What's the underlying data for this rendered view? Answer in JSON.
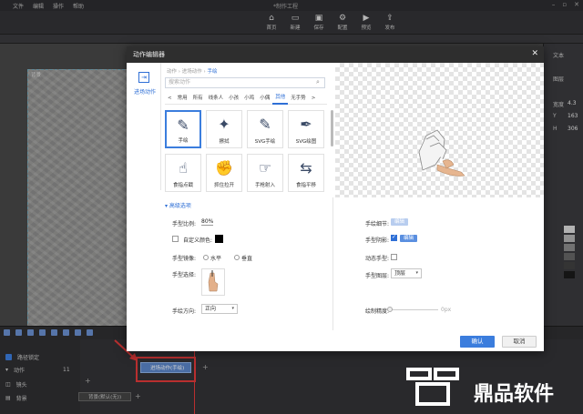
{
  "app": {
    "window_title": "*制作工程",
    "menus": [
      "文件",
      "编辑",
      "操作",
      "帮助"
    ]
  },
  "toolbar": [
    {
      "label": "首页",
      "icon": "home-icon"
    },
    {
      "label": "新建",
      "icon": "new-icon"
    },
    {
      "label": "保存",
      "icon": "save-icon"
    },
    {
      "label": "配置",
      "icon": "settings-icon"
    },
    {
      "label": "预览",
      "icon": "preview-icon"
    },
    {
      "label": "发布",
      "icon": "publish-icon"
    }
  ],
  "canvas": {
    "paper_label": "背景"
  },
  "right_panel": {
    "tab": "文本",
    "section": "图层",
    "x_label": "宽度",
    "x_value": "4.3",
    "y_label": "Y",
    "y_value": "163",
    "h_label": "H",
    "h_value": "306",
    "palette": [
      "#d9d9d9",
      "#b3b3b3",
      "#8c8c8c",
      "#666666",
      "#404040",
      "#1a1a1a"
    ]
  },
  "timeline": {
    "lock_label": "路径锁定",
    "rows": [
      {
        "label": "动作",
        "count": "11"
      },
      {
        "label": "镜头"
      },
      {
        "label": "背景"
      }
    ],
    "clip_label": "进场动作(手绘)",
    "bg_clip_label": "背景(默认(无))"
  },
  "dialog": {
    "title": "动作编辑器",
    "side_item": "进场动作",
    "breadcrumb": [
      "动作",
      "进场动作",
      "手绘"
    ],
    "search_placeholder": "搜索动作",
    "tabs": [
      "<",
      "常用",
      "所有",
      "线条人",
      "小孩",
      "小鸡",
      "小偶",
      "其他",
      "无手势",
      ">"
    ],
    "active_tab": "其他",
    "cards": [
      {
        "label": "手绘",
        "icon": "pen-icon",
        "selected": true
      },
      {
        "label": "擦拭",
        "icon": "magic-wand-icon"
      },
      {
        "label": "SVG手绘",
        "icon": "pen-icon"
      },
      {
        "label": "SVG绘图",
        "icon": "pen-feather-icon"
      },
      {
        "label": "食指点戳",
        "icon": "finger-tap-icon"
      },
      {
        "label": "抓住拉开",
        "icon": "hand-grab-icon"
      },
      {
        "label": "手枪射入",
        "icon": "hand-point-icon"
      },
      {
        "label": "食指平移",
        "icon": "swipe-icon"
      }
    ],
    "advanced": {
      "header": "高级选项",
      "hand_scale_label": "手型比例:",
      "hand_scale_value": "80%",
      "custom_color_label": "自定义颜色:",
      "custom_color": "#000000",
      "mirror_label": "手型镜像:",
      "mirror_options": [
        "水平",
        "垂直"
      ],
      "hand_select_label": "手型选择:",
      "direction_label": "手绘方向:",
      "direction_value": "正向",
      "detail_label": "手绘细节:",
      "detail_btn": "编辑",
      "shadow_label": "手型阴影:",
      "shadow_btn": "编辑",
      "dynamic_label": "动态手型:",
      "layer_label": "手型图层:",
      "layer_value": "顶层",
      "speed_label": "绘制精度:",
      "speed_value": "0px"
    },
    "ok_label": "确认",
    "cancel_label": "取消"
  },
  "watermark": {
    "text": "鼎品软件"
  }
}
